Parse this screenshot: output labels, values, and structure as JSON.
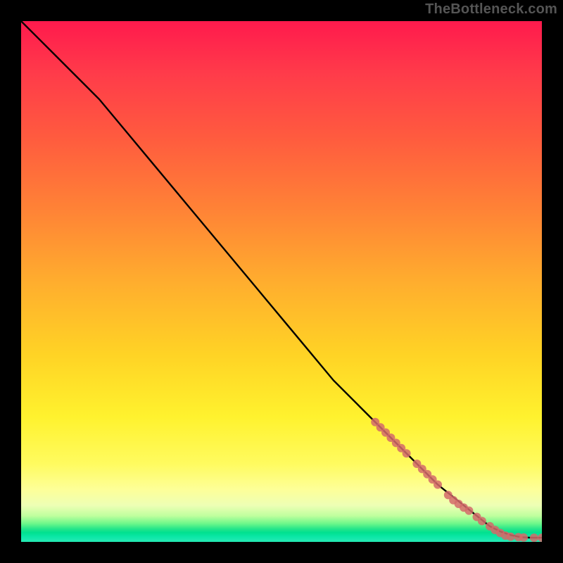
{
  "watermark": "TheBottleneck.com",
  "colors": {
    "frame": "#000000",
    "line": "#000000",
    "marker": "#d46a6a",
    "gradient_top": "#ff1a4d",
    "gradient_mid": "#ffd325",
    "gradient_bottom": "#00e18f"
  },
  "chart_data": {
    "type": "line",
    "title": "",
    "xlabel": "",
    "ylabel": "",
    "xlim": [
      0,
      100
    ],
    "ylim": [
      0,
      100
    ],
    "grid": false,
    "series": [
      {
        "name": "curve",
        "x": [
          0,
          3,
          6,
          10,
          15,
          20,
          25,
          30,
          35,
          40,
          45,
          50,
          55,
          60,
          65,
          70,
          75,
          80,
          85,
          90,
          92,
          94,
          96,
          98,
          100
        ],
        "y": [
          100,
          97,
          94,
          90,
          85,
          79,
          73,
          67,
          61,
          55,
          49,
          43,
          37,
          31,
          26,
          21,
          16,
          11,
          7,
          3,
          2,
          1.3,
          0.9,
          0.8,
          0.8
        ]
      }
    ],
    "markers": [
      {
        "x": 68,
        "y": 23
      },
      {
        "x": 69,
        "y": 22
      },
      {
        "x": 70,
        "y": 21
      },
      {
        "x": 71,
        "y": 20
      },
      {
        "x": 72,
        "y": 19
      },
      {
        "x": 73,
        "y": 18
      },
      {
        "x": 74,
        "y": 17
      },
      {
        "x": 76,
        "y": 15
      },
      {
        "x": 77,
        "y": 14
      },
      {
        "x": 78,
        "y": 13
      },
      {
        "x": 79,
        "y": 12
      },
      {
        "x": 80,
        "y": 11
      },
      {
        "x": 82,
        "y": 9
      },
      {
        "x": 83,
        "y": 8
      },
      {
        "x": 84,
        "y": 7.3
      },
      {
        "x": 85,
        "y": 6.6
      },
      {
        "x": 86,
        "y": 6
      },
      {
        "x": 87.5,
        "y": 4.8
      },
      {
        "x": 88.5,
        "y": 4
      },
      {
        "x": 90,
        "y": 3
      },
      {
        "x": 91,
        "y": 2.3
      },
      {
        "x": 92,
        "y": 1.7
      },
      {
        "x": 93,
        "y": 1.2
      },
      {
        "x": 94,
        "y": 1
      },
      {
        "x": 95.5,
        "y": 0.9
      },
      {
        "x": 96.5,
        "y": 0.85
      },
      {
        "x": 98.5,
        "y": 0.8
      },
      {
        "x": 100,
        "y": 0.8
      }
    ]
  }
}
